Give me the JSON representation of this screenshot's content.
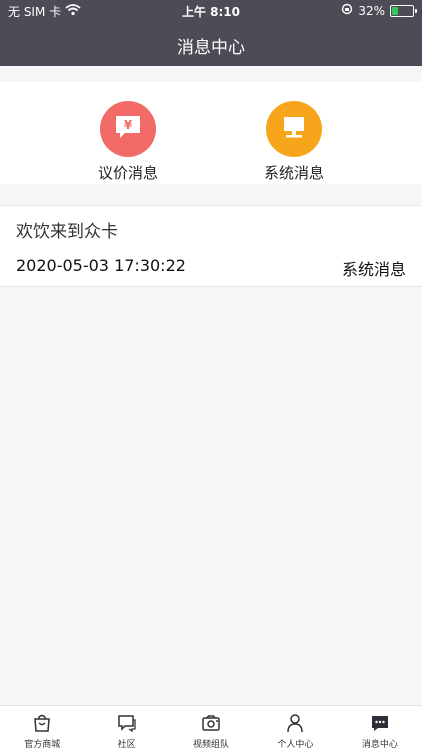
{
  "status_bar": {
    "carrier": "无 SIM 卡",
    "time": "上午 8:10",
    "battery": "32%",
    "battery_level": 0.32
  },
  "nav": {
    "title": "消息中心"
  },
  "categories": [
    {
      "label": "议价消息",
      "icon": "yen-chat-icon",
      "color": "#f26b66"
    },
    {
      "label": "系统消息",
      "icon": "monitor-icon",
      "color": "#f7a51b"
    }
  ],
  "messages": [
    {
      "title": "欢饮来到众卡",
      "date": "2020-05-03 17:30:22",
      "type": "系统消息"
    }
  ],
  "tabs": [
    {
      "label": "官方商城",
      "icon": "shop-bag-icon"
    },
    {
      "label": "社区",
      "icon": "chat-bubble-icon"
    },
    {
      "label": "视频组队",
      "icon": "camera-icon"
    },
    {
      "label": "个人中心",
      "icon": "person-icon"
    },
    {
      "label": "消息中心",
      "icon": "message-icon",
      "active": true
    }
  ]
}
